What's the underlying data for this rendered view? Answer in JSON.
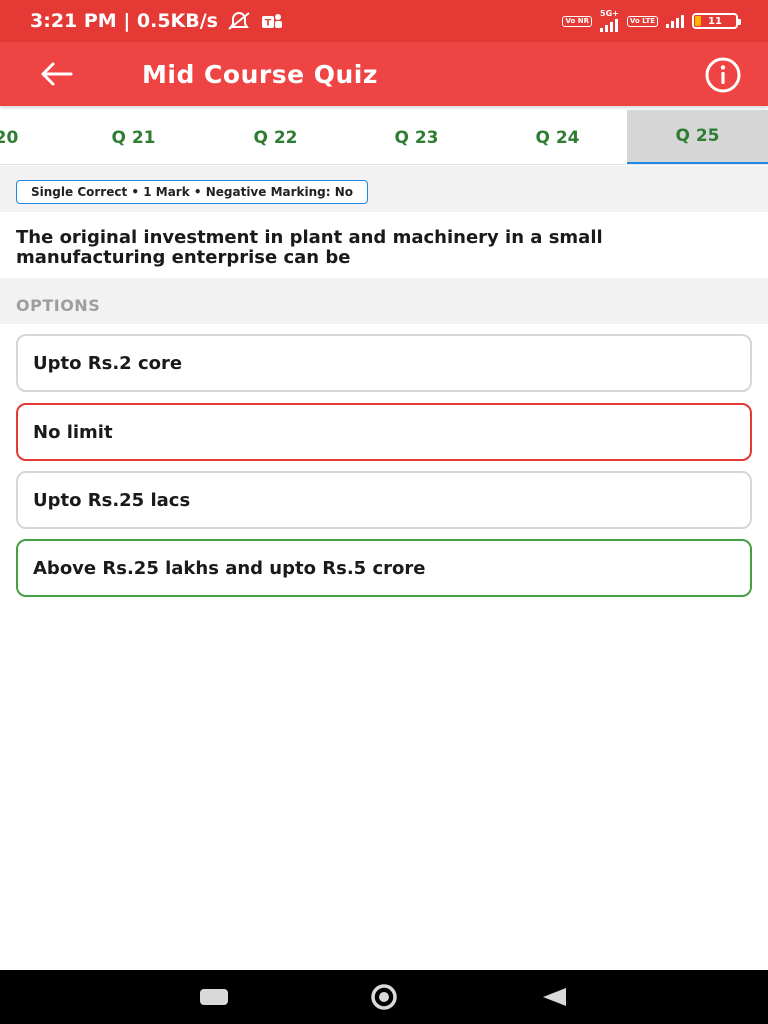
{
  "status_bar": {
    "time_speed": "3:21 PM | 0.5KB/s",
    "sim1_tag": "Vo NR",
    "network_type": "5G+",
    "sim2_tag": "Vo LTE",
    "battery_level": "11",
    "icons": [
      "alarm-off-icon",
      "teams-icon",
      "signal-icon",
      "battery-icon"
    ]
  },
  "app_bar": {
    "title": "Mid Course Quiz",
    "back_icon": "arrow-left-icon",
    "info_icon": "info-icon",
    "background": "#ef4444"
  },
  "tabs": [
    {
      "label": "20"
    },
    {
      "label": "Q 21"
    },
    {
      "label": "Q 22"
    },
    {
      "label": "Q 23"
    },
    {
      "label": "Q 24"
    },
    {
      "label": "Q 25",
      "active": true
    }
  ],
  "question": {
    "meta": "Single Correct • 1 Mark • Negative Marking: No",
    "text": "The original investment in plant and machinery in a small manufacturing enterprise can be",
    "options_heading": "OPTIONS",
    "options": [
      {
        "label": "Upto Rs.2 core",
        "state": "neutral"
      },
      {
        "label": "No limit",
        "state": "wrong"
      },
      {
        "label": "Upto Rs.25 lacs",
        "state": "neutral"
      },
      {
        "label": "Above Rs.25 lakhs and upto Rs.5 crore",
        "state": "correct"
      }
    ]
  },
  "colors": {
    "accent": "#e53935",
    "correct": "#43a047",
    "wrong": "#e53935",
    "tab_text": "#2e7d32",
    "tab_indicator": "#1e88e5"
  },
  "nav_bar": {
    "icons": [
      "recents-icon",
      "home-icon",
      "back-triangle-icon"
    ]
  }
}
